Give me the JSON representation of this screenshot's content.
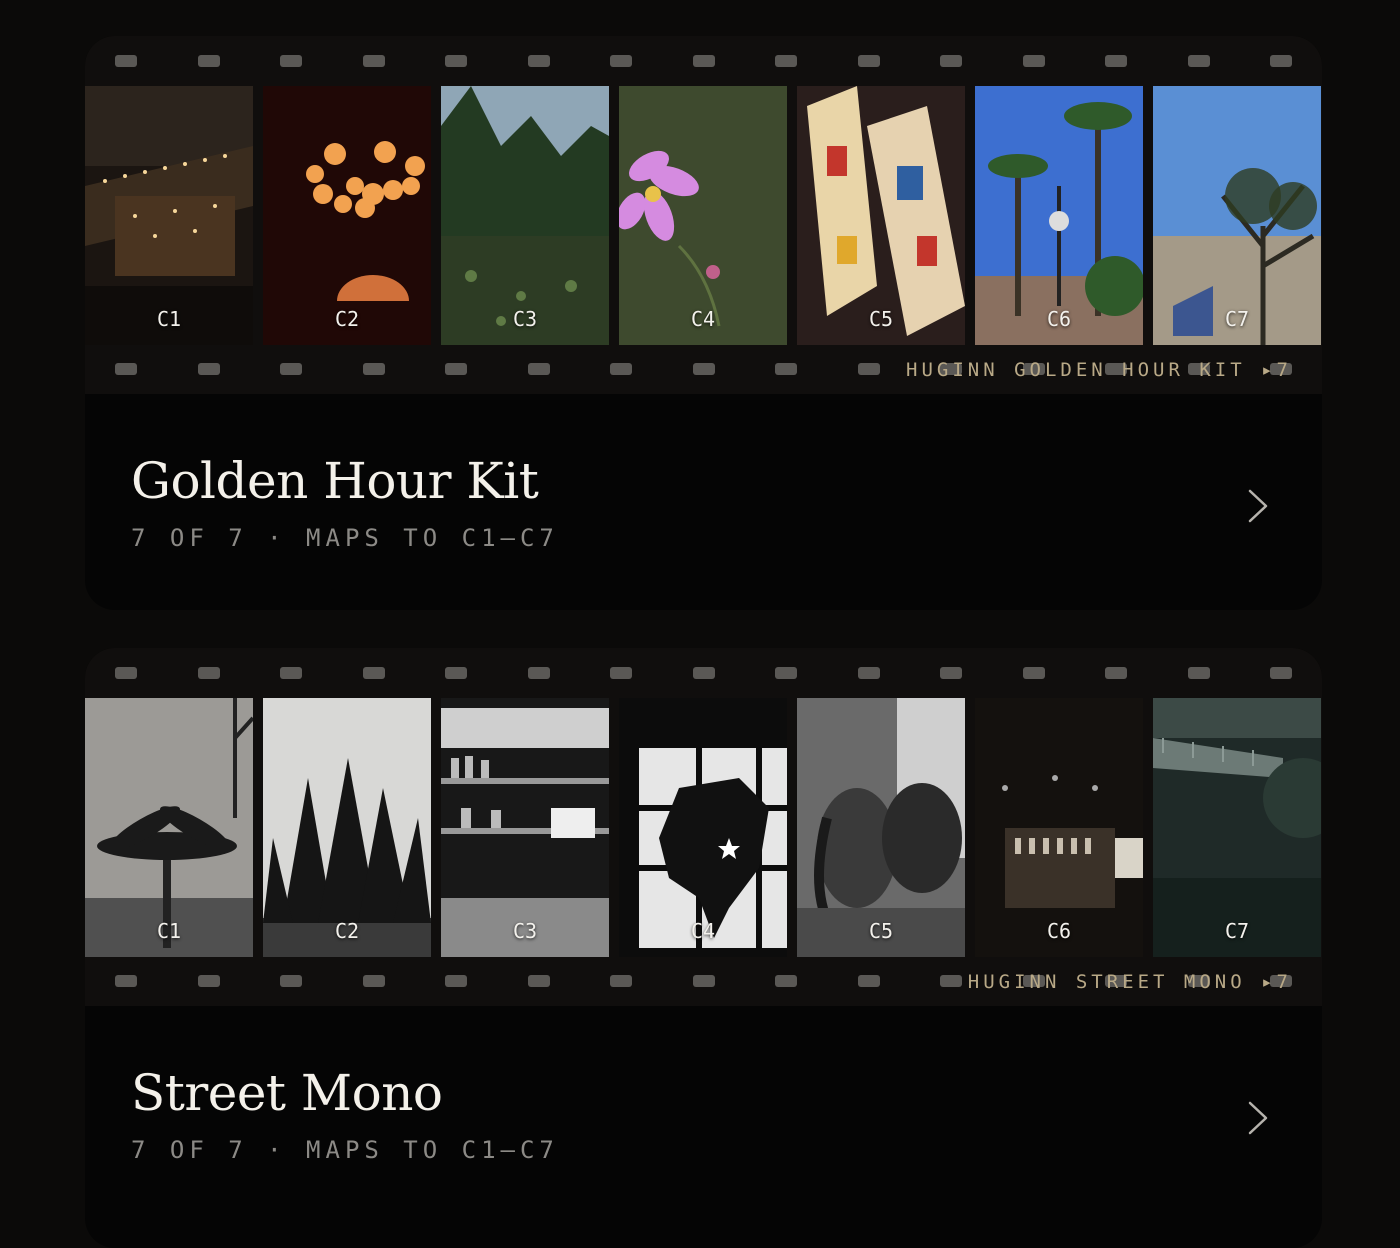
{
  "kits": [
    {
      "title": "Golden Hour Kit",
      "subtitle": "7 OF 7 · MAPS TO C1—C7",
      "strip_caption": "HUGINN GOLDEN HOUR KIT ▸7",
      "frames": [
        {
          "label": "C1",
          "icon": "restaurant-interior-photo"
        },
        {
          "label": "C2",
          "icon": "lanterns-photo"
        },
        {
          "label": "C3",
          "icon": "forest-pond-photo"
        },
        {
          "label": "C4",
          "icon": "pink-flower-photo"
        },
        {
          "label": "C5",
          "icon": "playing-cards-photo"
        },
        {
          "label": "C6",
          "icon": "palm-trees-photo"
        },
        {
          "label": "C7",
          "icon": "tree-building-photo"
        }
      ]
    },
    {
      "title": "Street Mono",
      "subtitle": "7 OF 7 · MAPS TO C1—C7",
      "strip_caption": "HUGINN STREET MONO ▸7",
      "frames": [
        {
          "label": "C1",
          "icon": "bw-palm-photo"
        },
        {
          "label": "C2",
          "icon": "bw-pines-photo"
        },
        {
          "label": "C3",
          "icon": "bw-bar-shelves-photo"
        },
        {
          "label": "C4",
          "icon": "bw-window-map-photo"
        },
        {
          "label": "C5",
          "icon": "bw-elephant-photo"
        },
        {
          "label": "C6",
          "icon": "bw-bar-interior-photo"
        },
        {
          "label": "C7",
          "icon": "bw-bridge-photo"
        }
      ]
    }
  ]
}
